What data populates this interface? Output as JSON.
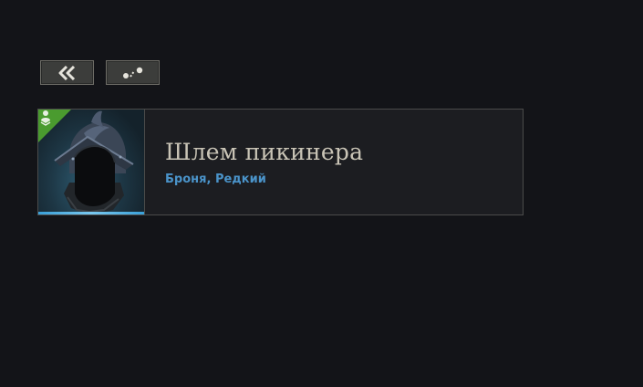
{
  "toolbar": {
    "back_icon": "double-chevron-left-icon",
    "share_icon": "share-icon"
  },
  "item": {
    "name": "Шлем пикинера",
    "type_rarity": "Броня, Редкий",
    "icon": "helmet-icon",
    "badge_icon": "character-marker-icon",
    "rarity_color": "#4a93c9",
    "badge_color": "#4a9b2f"
  }
}
